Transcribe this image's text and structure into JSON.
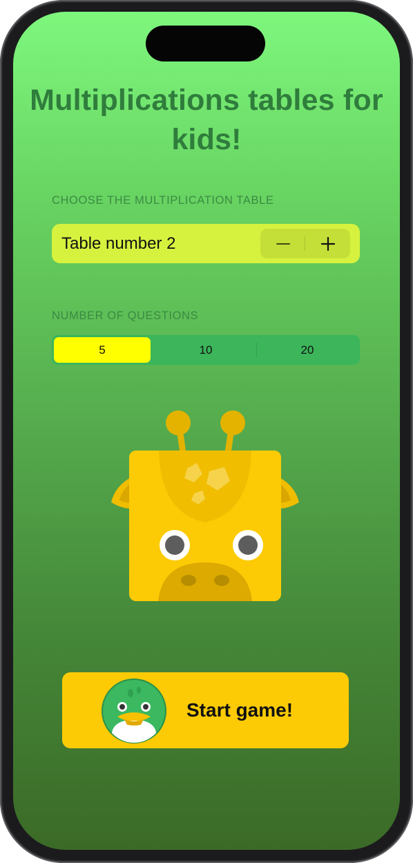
{
  "app": {
    "title": "Multiplications tables for kids!"
  },
  "table_section": {
    "header": "CHOOSE THE MULTIPLICATION TABLE",
    "stepper_label": "Table number 2",
    "stepper_value": 2,
    "minus_icon": "minus-icon",
    "plus_icon": "plus-icon"
  },
  "questions_section": {
    "header": "NUMBER OF QUESTIONS",
    "options": [
      "5",
      "10",
      "20"
    ],
    "selected": "5"
  },
  "mascot": {
    "icon": "giraffe-icon"
  },
  "start_button": {
    "label": "Start game!",
    "icon": "duck-icon"
  },
  "colors": {
    "background_top": "#7ef77d",
    "background_bottom": "#3b6a27",
    "title": "#2f7d3c",
    "stepper_bg": "#d6f23e",
    "segment_bg": "#3cb55b",
    "segment_selected": "#ffff00",
    "button_bg": "#fdcb05",
    "giraffe": "#fdcb05"
  }
}
